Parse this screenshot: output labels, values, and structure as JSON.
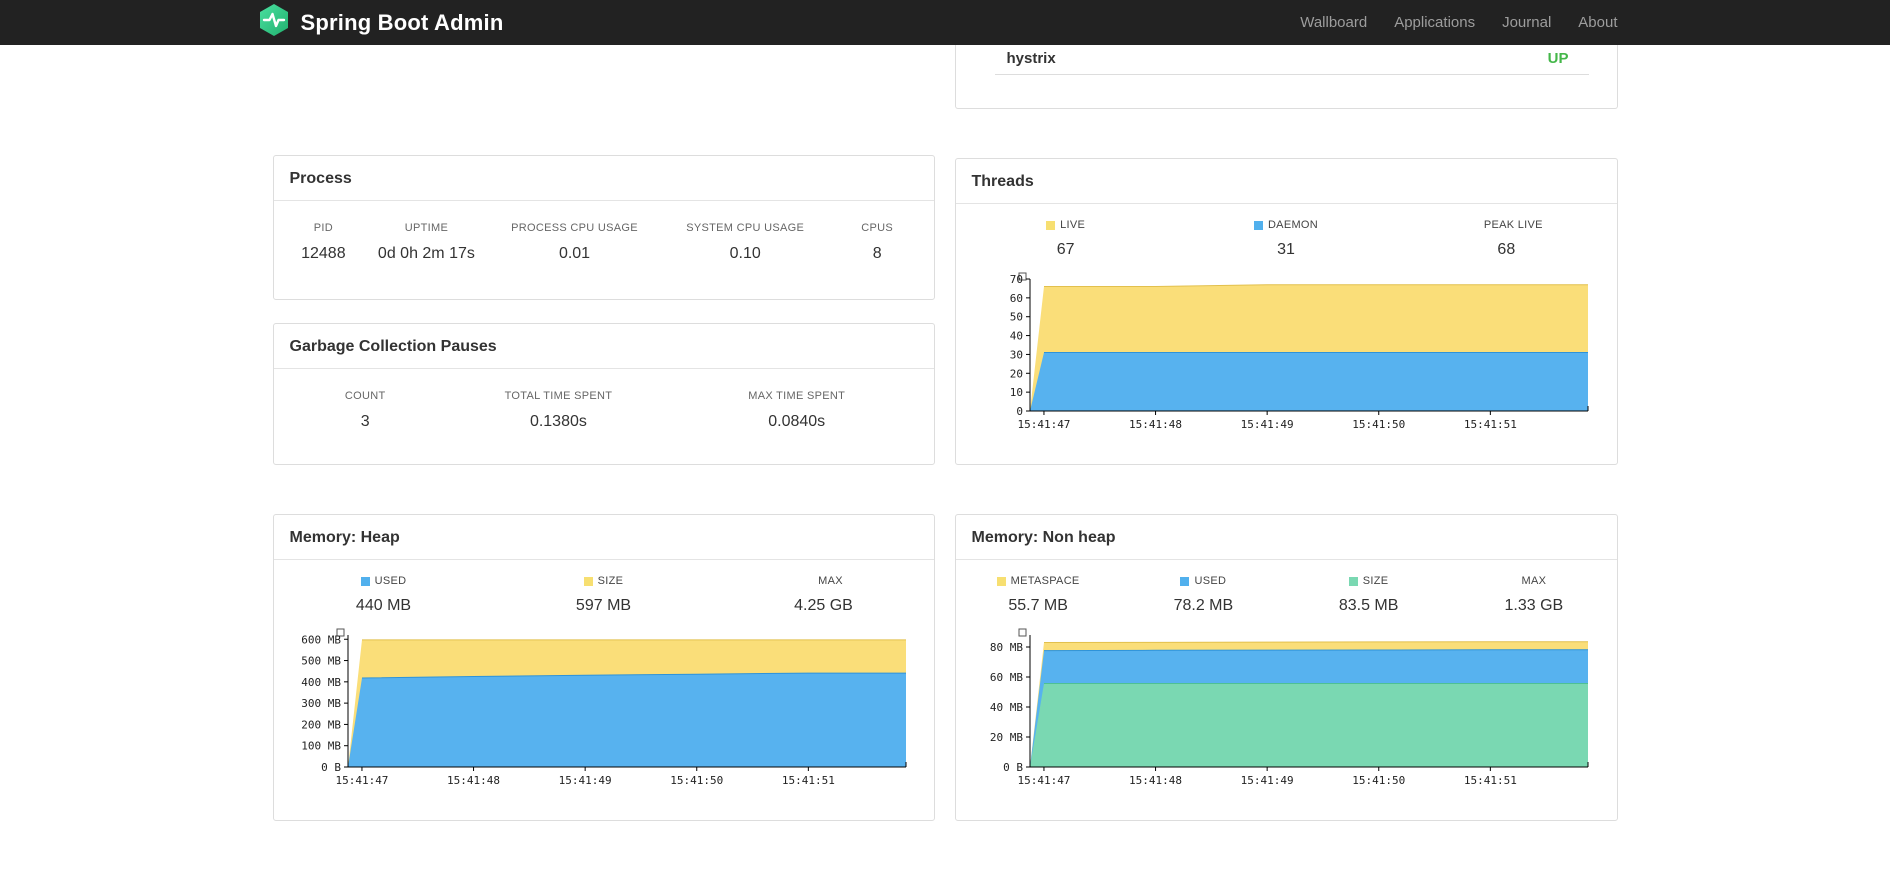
{
  "navbar": {
    "brand": "Spring Boot Admin",
    "links": [
      {
        "label": "Wallboard"
      },
      {
        "label": "Applications"
      },
      {
        "label": "Journal"
      },
      {
        "label": "About"
      }
    ]
  },
  "colors": {
    "navbar_bg": "#222222",
    "brand_green_top": "#4ae0a0",
    "brand_green_bottom": "#21b06e",
    "status_up": "#44b749"
  },
  "health": {
    "service": "hystrix",
    "status": "UP"
  },
  "process": {
    "title": "Process",
    "metrics": [
      {
        "label": "PID",
        "value": "12488"
      },
      {
        "label": "UPTIME",
        "value": "0d 0h 2m 17s"
      },
      {
        "label": "PROCESS CPU USAGE",
        "value": "0.01"
      },
      {
        "label": "SYSTEM CPU USAGE",
        "value": "0.10"
      },
      {
        "label": "CPUS",
        "value": "8"
      }
    ]
  },
  "gc": {
    "title": "Garbage Collection Pauses",
    "metrics": [
      {
        "label": "COUNT",
        "value": "3"
      },
      {
        "label": "TOTAL TIME SPENT",
        "value": "0.1380s"
      },
      {
        "label": "MAX TIME SPENT",
        "value": "0.0840s"
      }
    ]
  },
  "charts": {
    "threads": {
      "title": "Threads",
      "legend": [
        {
          "label": "LIVE",
          "value": "67",
          "color": "#f7df71"
        },
        {
          "label": "DAEMON",
          "value": "31",
          "color": "#51b0ed"
        },
        {
          "label": "PEAK LIVE",
          "value": "68",
          "color": null
        }
      ],
      "chart_data": {
        "type": "area",
        "x": [
          "15:41:47",
          "15:41:48",
          "15:41:49",
          "15:41:50",
          "15:41:51"
        ],
        "ymax": 70,
        "yticks": [
          {
            "v": 70,
            "label": "70"
          },
          {
            "v": 60,
            "label": "60"
          },
          {
            "v": 50,
            "label": "50"
          },
          {
            "v": 40,
            "label": "40"
          },
          {
            "v": 30,
            "label": "30"
          },
          {
            "v": 20,
            "label": "20"
          },
          {
            "v": 10,
            "label": "10"
          },
          {
            "v": 0,
            "label": "0"
          }
        ],
        "series": [
          {
            "name": "LIVE",
            "color": "#fade79",
            "stroke": "#e2c04d",
            "values": [
              66,
              66,
              67,
              67,
              67
            ]
          },
          {
            "name": "DAEMON",
            "color": "#57b2ef",
            "stroke": "#2e93d9",
            "values": [
              31,
              31,
              31,
              31,
              31
            ]
          }
        ]
      }
    },
    "heap": {
      "title": "Memory: Heap",
      "legend": [
        {
          "label": "USED",
          "value": "440 MB",
          "color": "#51b0ed"
        },
        {
          "label": "SIZE",
          "value": "597 MB",
          "color": "#f7df71"
        },
        {
          "label": "MAX",
          "value": "4.25 GB",
          "color": null
        }
      ],
      "chart_data": {
        "type": "area",
        "x": [
          "15:41:47",
          "15:41:48",
          "15:41:49",
          "15:41:50",
          "15:41:51"
        ],
        "ymax": 620,
        "yticks": [
          {
            "v": 600,
            "label": "600 MB"
          },
          {
            "v": 500,
            "label": "500 MB"
          },
          {
            "v": 400,
            "label": "400 MB"
          },
          {
            "v": 300,
            "label": "300 MB"
          },
          {
            "v": 200,
            "label": "200 MB"
          },
          {
            "v": 100,
            "label": "100 MB"
          },
          {
            "v": 0,
            "label": "0 B"
          }
        ],
        "series": [
          {
            "name": "SIZE",
            "color": "#fade79",
            "stroke": "#e2c04d",
            "values": [
              597,
              597,
              597,
              597,
              597
            ]
          },
          {
            "name": "USED",
            "color": "#57b2ef",
            "stroke": "#2e93d9",
            "values": [
              418,
              425,
              431,
              436,
              441
            ]
          }
        ]
      }
    },
    "nonheap": {
      "title": "Memory: Non heap",
      "legend": [
        {
          "label": "METASPACE",
          "value": "55.7 MB",
          "color": "#7ad8b2"
        },
        {
          "label": "USED",
          "value": "78.2 MB",
          "color": "#51b0ed"
        },
        {
          "label": "SIZE",
          "value": "83.5 MB",
          "color": "#f7df71"
        },
        {
          "label": "MAX",
          "value": "1.33 GB",
          "color": null
        }
      ],
      "chart_data": {
        "type": "area",
        "x": [
          "15:41:47",
          "15:41:48",
          "15:41:49",
          "15:41:50",
          "15:41:51"
        ],
        "ymax": 88,
        "yticks": [
          {
            "v": 80,
            "label": "80 MB"
          },
          {
            "v": 60,
            "label": "60 MB"
          },
          {
            "v": 40,
            "label": "40 MB"
          },
          {
            "v": 20,
            "label": "20 MB"
          },
          {
            "v": 0,
            "label": "0 B"
          }
        ],
        "series": [
          {
            "name": "SIZE",
            "color": "#fade79",
            "stroke": "#e2c04d",
            "values": [
              83,
              83.1,
              83.3,
              83.4,
              83.5
            ]
          },
          {
            "name": "USED",
            "color": "#57b2ef",
            "stroke": "#2e93d9",
            "values": [
              77.6,
              77.8,
              77.9,
              78,
              78.2
            ]
          },
          {
            "name": "METASPACE",
            "color": "#7ad8b2",
            "stroke": "#4ec094",
            "values": [
              55.7,
              55.7,
              55.7,
              55.7,
              55.7
            ]
          }
        ]
      }
    }
  }
}
